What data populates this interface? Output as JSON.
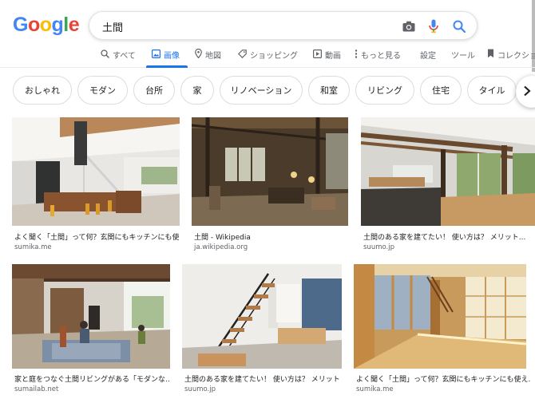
{
  "search": {
    "query": "土間"
  },
  "tabs": [
    {
      "label": "すべて",
      "icon": "search-icon"
    },
    {
      "label": "画像",
      "icon": "image-icon"
    },
    {
      "label": "地図",
      "icon": "map-pin-icon"
    },
    {
      "label": "ショッピング",
      "icon": "tag-icon"
    },
    {
      "label": "動画",
      "icon": "play-icon"
    },
    {
      "label": "もっと見る",
      "icon": "more-vert-icon"
    },
    {
      "label": "設定"
    },
    {
      "label": "ツール"
    },
    {
      "label": "コレクション",
      "icon": "bookmark-icon"
    }
  ],
  "chips": [
    "おしゃれ",
    "モダン",
    "台所",
    "家",
    "リノベーション",
    "和室",
    "リビング",
    "住宅",
    "タイル"
  ],
  "results": [
    {
      "title": "よく聞く「土間」って何？玄関にもキッチンにも使え...",
      "source": "sumika.me"
    },
    {
      "title": "土間 - Wikipedia",
      "source": "ja.wikipedia.org"
    },
    {
      "title": "土間のある家を建てたい！ 使い方は？ メリット...",
      "source": "suumo.jp"
    },
    {
      "title": "家と庭をつなぐ土間リビングがある「モダンな...",
      "source": "sumailab.net"
    },
    {
      "title": "土間のある家を建てたい！ 使い方は？ メリット...",
      "source": "suumo.jp"
    },
    {
      "title": "よく聞く「土間」って何？玄関にもキッチンにも使え...",
      "source": "sumika.me"
    }
  ],
  "colors": {
    "accent": "#1a73e8",
    "border": "#dadce0",
    "text_secondary": "#5f6368"
  }
}
